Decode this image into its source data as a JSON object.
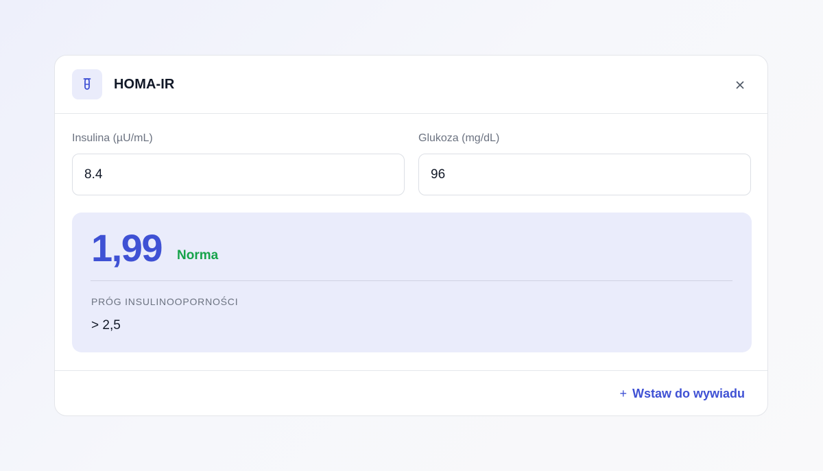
{
  "dialog": {
    "title": "HOMA-IR",
    "icon": "test-tube-icon",
    "close_icon": "close-icon"
  },
  "fields": {
    "insulin": {
      "label": "Insulina (µU/mL)",
      "value": "8.4"
    },
    "glucose": {
      "label": "Glukoza (mg/dL)",
      "value": "96"
    }
  },
  "result": {
    "value": "1,99",
    "status": "Norma",
    "threshold_label": "PRÓG INSULINOOPORNOŚCI",
    "threshold_value": "> 2,5"
  },
  "footer": {
    "insert_icon": "plus-icon",
    "insert_plus": "+",
    "insert_label": "Wstaw do wywiadu"
  },
  "colors": {
    "accent": "#3f51d4",
    "status_ok": "#16a34a",
    "panel_bg": "#eaecfb"
  }
}
